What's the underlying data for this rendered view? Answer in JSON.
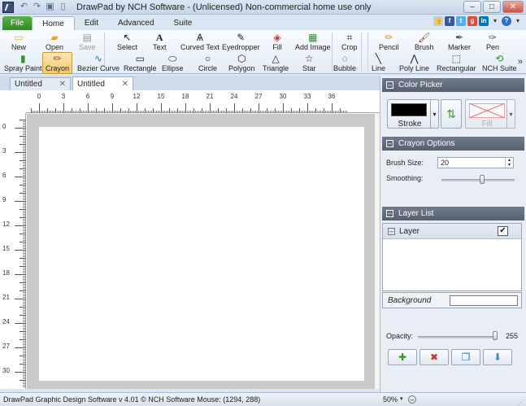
{
  "window": {
    "title": "DrawPad by NCH Software - (Unlicensed) Non-commercial home use only"
  },
  "ribbon_tabs": [
    "File",
    "Home",
    "Edit",
    "Advanced",
    "Suite"
  ],
  "ribbon": {
    "row1": {
      "new": "New",
      "open": "Open",
      "save": "Save",
      "select": "Select",
      "text": "Text",
      "curved_text": "Curved Text",
      "eyedropper": "Eyedropper",
      "fill": "Fill",
      "add_image": "Add Image",
      "crop": "Crop",
      "pencil": "Pencil",
      "brush": "Brush",
      "marker": "Marker",
      "pen": "Pen"
    },
    "row2": {
      "spray_paint": "Spray Paint",
      "crayon": "Crayon",
      "bezier_curve": "Bezier Curve",
      "rectangle": "Rectangle",
      "ellipse": "Ellipse",
      "circle": "Circle",
      "polygon": "Polygon",
      "triangle": "Triangle",
      "star": "Star",
      "bubble": "Bubble",
      "line": "Line",
      "poly_line": "Poly Line",
      "rectangular": "Rectangular",
      "nch_suite": "NCH Suite"
    }
  },
  "doc_tabs": [
    {
      "label": "Untitled"
    },
    {
      "label": "Untitled"
    }
  ],
  "rulers": {
    "h_labels": [
      "0",
      "3",
      "6",
      "9",
      "12",
      "15",
      "18",
      "21",
      "24",
      "27",
      "30",
      "33",
      "36"
    ],
    "v_labels": [
      "0",
      "3",
      "6",
      "9",
      "12",
      "15",
      "18",
      "21",
      "24",
      "27",
      "30"
    ]
  },
  "panels": {
    "color_picker": {
      "title": "Color Picker",
      "stroke_label": "Stroke",
      "fill_label": "Fill",
      "stroke_color": "#000000"
    },
    "crayon_options": {
      "title": "Crayon Options",
      "brush_size_label": "Brush Size:",
      "brush_size_value": "20",
      "smoothing_label": "Smoothing:",
      "smoothing_level": 0.55
    },
    "layer_list": {
      "title": "Layer List",
      "layers": [
        {
          "name": "Layer",
          "visible": true
        }
      ],
      "background_label": "Background",
      "opacity_label": "Opacity:",
      "opacity_value": "255",
      "opacity_level": 1.0
    }
  },
  "statusbar": {
    "text": "DrawPad Graphic Design Software v 4.01 © NCH Software Mouse: (1294, 288)",
    "zoom": "50%"
  }
}
